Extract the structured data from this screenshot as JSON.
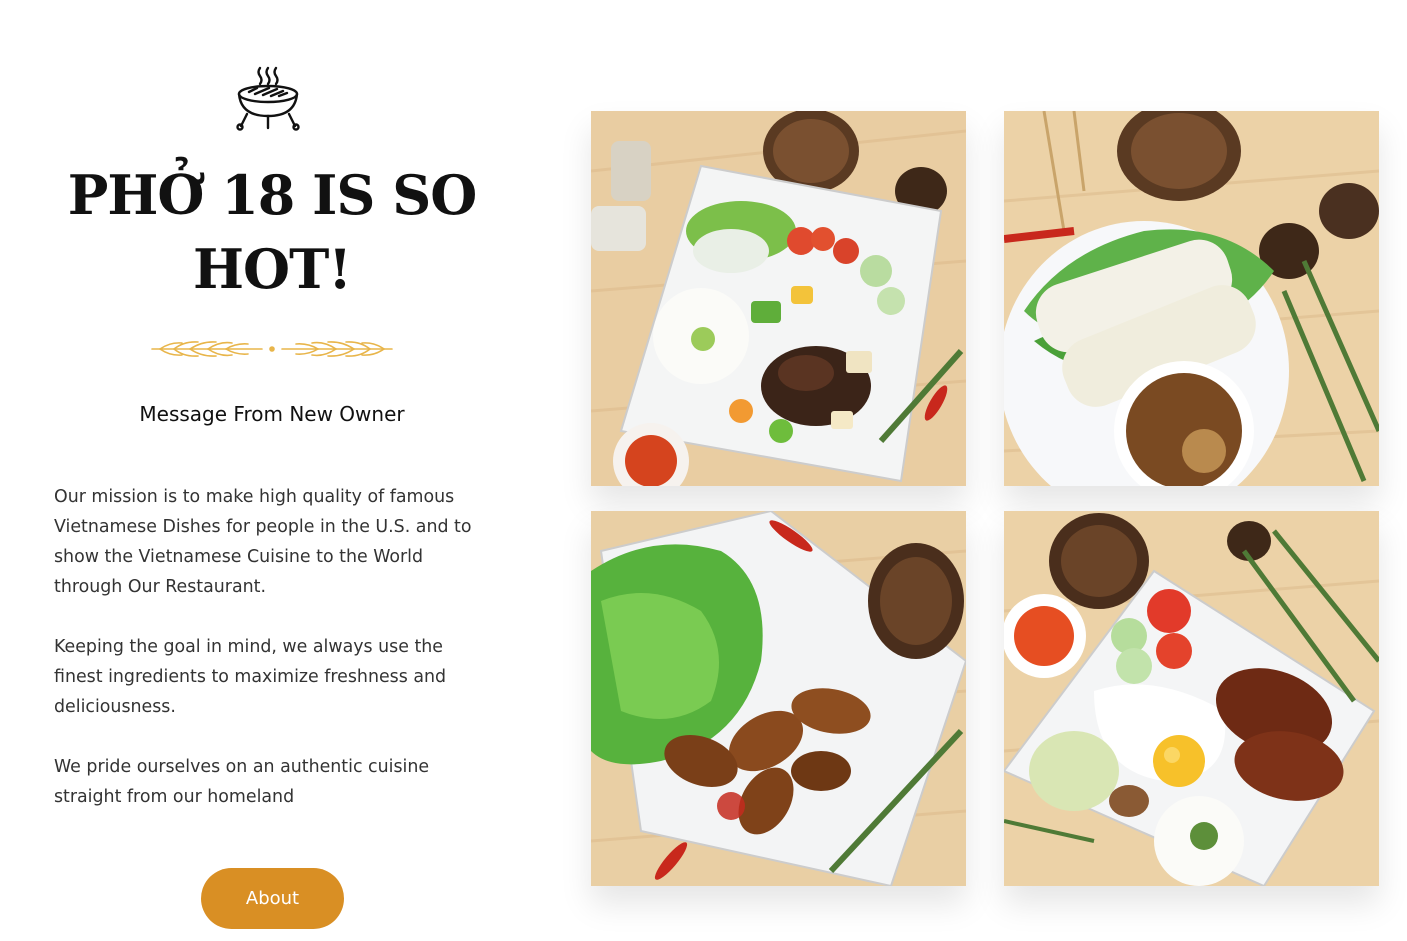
{
  "section": {
    "icon": "grill-icon",
    "title_line1": "PHỞ 18 IS SO",
    "title_line2": "HOT!",
    "divider_icon": "wheat-divider-icon",
    "subtitle": "Message From New Owner",
    "paragraphs": [
      "Our mission is to make high quality of famous Vietnamese Dishes for people in the U.S. and to show the Vietnamese Cuisine to the World through Our Restaurant.",
      "Keeping the goal in mind, we always use the finest ingredients to maximize freshness and deliciousness.",
      "We pride ourselves on an authentic cuisine straight from our homeland"
    ],
    "button_label": "About"
  },
  "colors": {
    "accent": "#d98f24",
    "divider": "#e8b54a",
    "wood": "#e8c99a"
  },
  "gallery": [
    {
      "icon": "rice-plate-photo"
    },
    {
      "icon": "spring-rolls-photo"
    },
    {
      "icon": "chicken-wings-photo"
    },
    {
      "icon": "broken-rice-pork-egg-photo"
    }
  ]
}
